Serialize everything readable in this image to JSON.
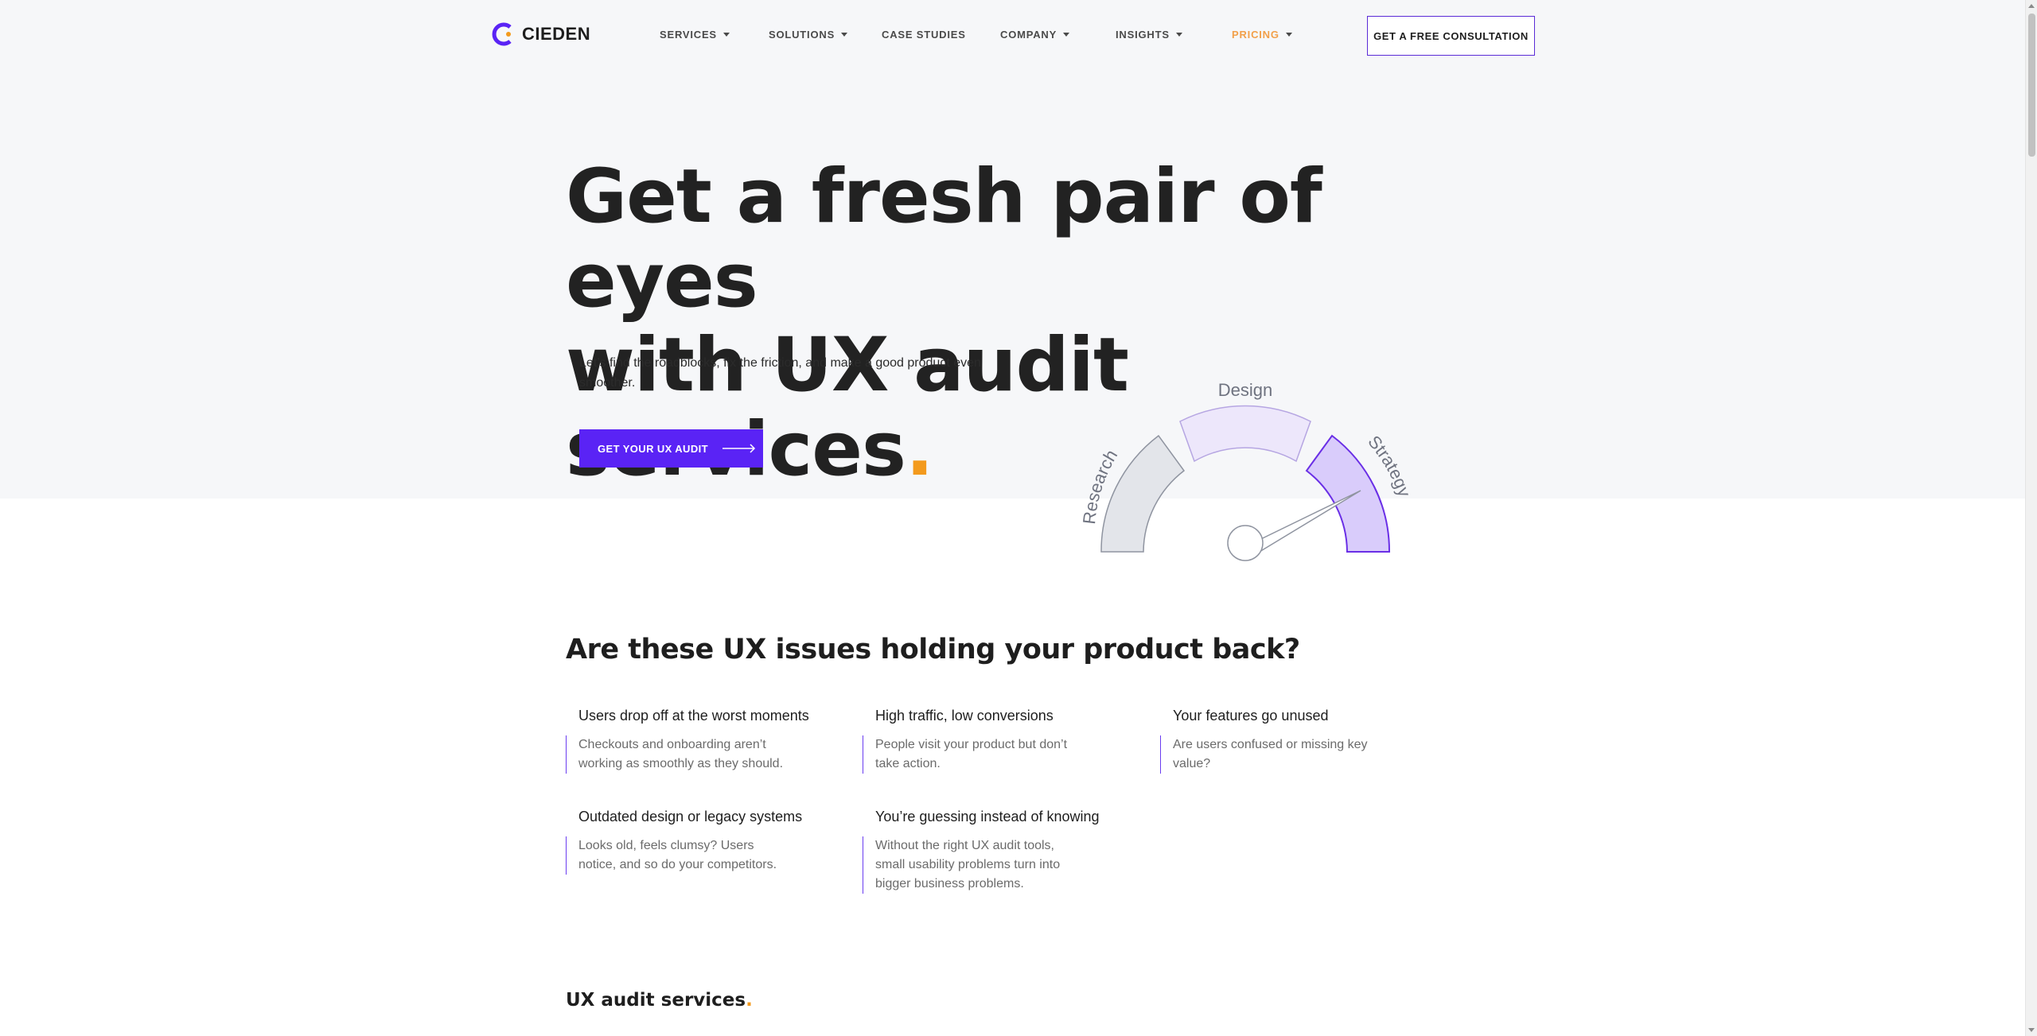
{
  "brand": {
    "name": "CIEDEN",
    "accent": "#5a23f5",
    "dot_color": "#f39a1d"
  },
  "nav": {
    "items": [
      {
        "label": "SERVICES",
        "has_dropdown": true
      },
      {
        "label": "SOLUTIONS",
        "has_dropdown": true
      },
      {
        "label": "CASE STUDIES",
        "has_dropdown": false
      },
      {
        "label": "COMPANY",
        "has_dropdown": true
      },
      {
        "label": "INSIGHTS",
        "has_dropdown": true
      },
      {
        "label": "PRICING",
        "has_dropdown": true
      }
    ],
    "cta": "GET A FREE CONSULTATION"
  },
  "hero": {
    "title_line1": "Get a fresh pair of eyes",
    "title_line2": "with UX audit services",
    "title_dot": ".",
    "subtitle": "Let’s find the roadblocks, fix the friction, and make a good product even smoother.",
    "button": "GET YOUR UX AUDIT"
  },
  "gauge": {
    "labels": [
      "Research",
      "Design",
      "Strategy"
    ],
    "active": "Strategy"
  },
  "issues": {
    "title": "Are these UX issues holding your product back?",
    "items": [
      {
        "title": "Users drop off at the worst moments",
        "desc": "Checkouts and onboarding aren’t working as smoothly as they should."
      },
      {
        "title": "High traffic, low conversions",
        "desc": "People visit your product but don’t take action."
      },
      {
        "title": "Your features go unused",
        "desc": "Are users confused or missing key value?"
      },
      {
        "title": "Outdated design or legacy systems",
        "desc": "Looks old, feels clumsy? Users notice, and so do your competitors."
      },
      {
        "title": "You’re guessing instead of knowing",
        "desc": "Without the right UX audit tools, small usability problems turn into bigger business problems."
      }
    ]
  },
  "services": {
    "title": "UX audit services",
    "dot": "."
  }
}
